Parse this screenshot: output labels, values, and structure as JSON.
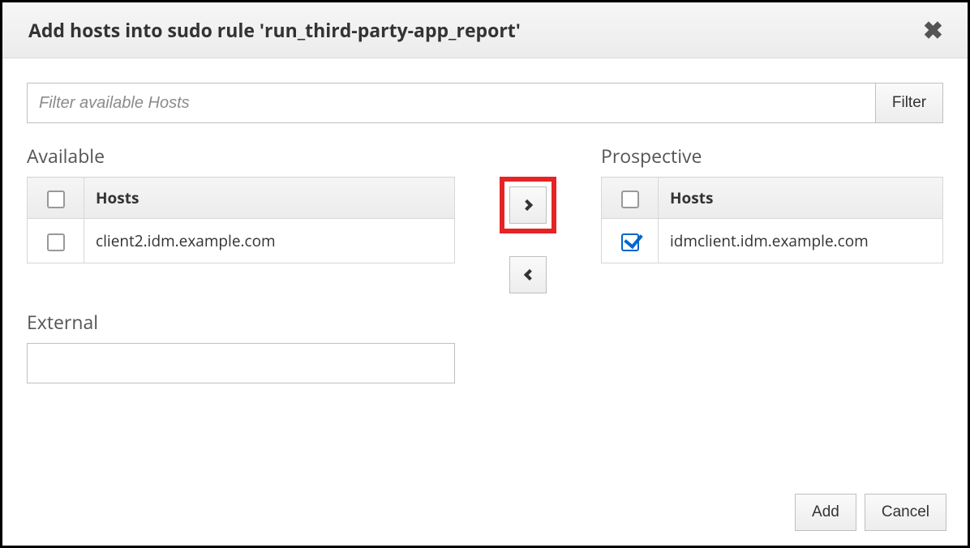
{
  "dialog": {
    "title": "Add hosts into sudo rule 'run_third-party-app_report'"
  },
  "filter": {
    "placeholder": "Filter available Hosts",
    "button": "Filter"
  },
  "available": {
    "title": "Available",
    "column": "Hosts",
    "rows": [
      {
        "host": "client2.idm.example.com",
        "checked": false
      }
    ]
  },
  "prospective": {
    "title": "Prospective",
    "column": "Hosts",
    "rows": [
      {
        "host": "idmclient.idm.example.com",
        "checked": true
      }
    ]
  },
  "external": {
    "title": "External",
    "value": ""
  },
  "actions": {
    "add": "Add",
    "cancel": "Cancel"
  }
}
